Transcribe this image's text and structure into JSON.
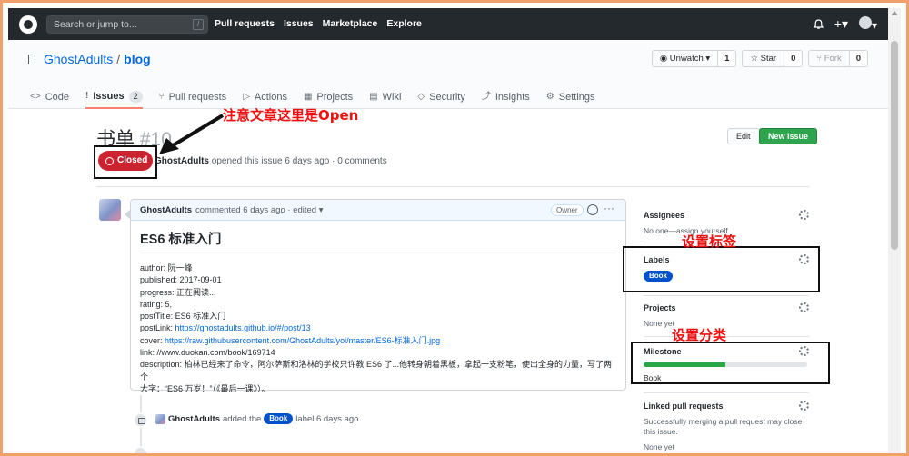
{
  "header": {
    "search_placeholder": "Search or jump to...",
    "search_shortcut": "/",
    "nav": [
      "Pull requests",
      "Issues",
      "Marketplace",
      "Explore"
    ],
    "bell_icon": "bell-icon",
    "plus_icon": "plus-icon"
  },
  "repo": {
    "owner": "GhostAdults",
    "separator": "/",
    "name": "blog",
    "watch": {
      "label": "Unwatch ▾",
      "count": "1"
    },
    "star": {
      "label": "Star",
      "count": "0"
    },
    "fork": {
      "label": "Fork",
      "count": "0"
    }
  },
  "tabs": [
    {
      "icon": "<>",
      "label": "Code"
    },
    {
      "icon": "!",
      "label": "Issues",
      "count": "2"
    },
    {
      "icon": "⑂",
      "label": "Pull requests"
    },
    {
      "icon": "▷",
      "label": "Actions"
    },
    {
      "icon": "▦",
      "label": "Projects"
    },
    {
      "icon": "▤",
      "label": "Wiki"
    },
    {
      "icon": "◇",
      "label": "Security"
    },
    {
      "icon": "⤴",
      "label": "Insights"
    },
    {
      "icon": "⚙",
      "label": "Settings"
    }
  ],
  "issue": {
    "title": "书单",
    "number": "#10",
    "edit_label": "Edit",
    "new_issue_label": "New issue",
    "state": "Closed",
    "author": "GhostAdults",
    "meta_text": "opened this issue 6 days ago · 0 comments"
  },
  "annotations": {
    "open_note": "注意文章这里是Open",
    "labels_note": "设置标签",
    "milestone_note": "设置分类"
  },
  "comment": {
    "author": "GhostAdults",
    "meta": "commented 6 days ago · edited ▾",
    "owner_badge": "Owner",
    "heading": "ES6 标准入门",
    "lines": [
      "author: 阮一峰",
      "published: 2017-09-01",
      "progress: 正在阅读...",
      "rating: 5,",
      "postTitle: ES6 标准入门",
      "postLink: ",
      "cover: ",
      "link: //www.duokan.com/book/169714",
      "description: 柏林已经来了命令，阿尔萨斯和洛林的学校只许教 ES6 了...他转身朝着黑板，拿起一支粉笔，使出全身的力量，写了两个",
      "大字：“ES6 万岁！”（《最后一课》）。"
    ],
    "post_link_url": "https://ghostadults.github.io/#/post/13",
    "cover_url": "https://raw.githubusercontent.com/GhostAdults/yoi/master/ES6-标准入门.jpg"
  },
  "timeline_event": {
    "actor": "GhostAdults",
    "action": "added the",
    "label": "Book",
    "suffix": "label 6 days ago"
  },
  "sidebar": {
    "assignees": {
      "title": "Assignees",
      "text": "No one—assign yourself"
    },
    "labels": {
      "title": "Labels",
      "label": "Book",
      "label_color": "#0052cc"
    },
    "projects": {
      "title": "Projects",
      "text": "None yet"
    },
    "milestone": {
      "title": "Milestone",
      "name": "Book",
      "progress": 0.5
    },
    "linked_prs": {
      "title": "Linked pull requests",
      "text": "Successfully merging a pull request may close this issue.",
      "text2": "None yet"
    }
  },
  "colors": {
    "closed": "#cb2431",
    "new_issue": "#2ea44f",
    "label": "#0052cc",
    "annotation": "#ee1111",
    "header": "#24292e"
  }
}
